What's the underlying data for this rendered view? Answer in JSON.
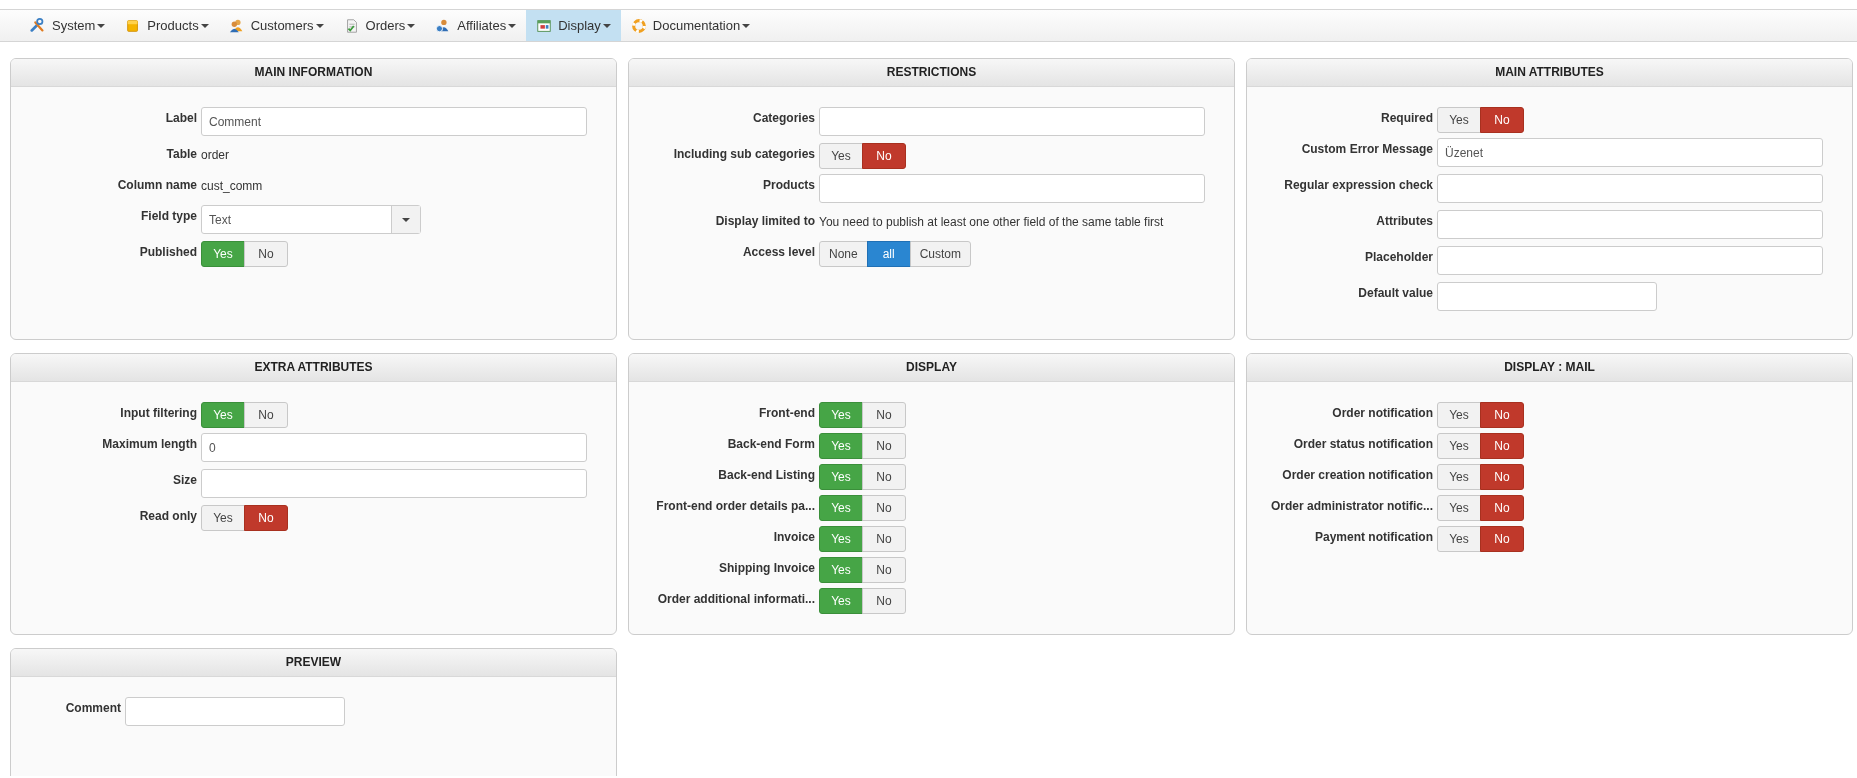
{
  "menu": [
    {
      "label": "System",
      "selected": false
    },
    {
      "label": "Products",
      "selected": false
    },
    {
      "label": "Customers",
      "selected": false
    },
    {
      "label": "Orders",
      "selected": false
    },
    {
      "label": "Affiliates",
      "selected": false
    },
    {
      "label": "Display",
      "selected": true
    },
    {
      "label": "Documentation",
      "selected": false
    }
  ],
  "panels": [
    {
      "title": "MAIN INFORMATION",
      "rows": [
        {
          "kind": "input",
          "label": "Label",
          "value": "Comment"
        },
        {
          "kind": "text",
          "label": "Table",
          "value": "order"
        },
        {
          "kind": "text",
          "label": "Column name",
          "value": "cust_comm"
        },
        {
          "kind": "select",
          "label": "Field type",
          "value": "Text"
        },
        {
          "kind": "toggle",
          "label": "Published",
          "options": [
            {
              "label": "Yes",
              "selected": true
            },
            {
              "label": "No",
              "selected": false
            }
          ]
        }
      ]
    },
    {
      "title": "RESTRICTIONS",
      "rows": [
        {
          "kind": "input",
          "label": "Categories",
          "value": ""
        },
        {
          "kind": "toggle",
          "label": "Including sub categories",
          "options": [
            {
              "label": "Yes",
              "selected": false
            },
            {
              "label": "No",
              "selected": true
            }
          ]
        },
        {
          "kind": "input",
          "label": "Products",
          "value": ""
        },
        {
          "kind": "text",
          "label": "Display limited to",
          "value": "You need to publish at least one other field of the same table first"
        },
        {
          "kind": "choice",
          "label": "Access level",
          "options": [
            {
              "label": "None",
              "selected": false
            },
            {
              "label": "all",
              "selected": true
            },
            {
              "label": "Custom",
              "selected": false
            }
          ]
        }
      ]
    },
    {
      "title": "MAIN ATTRIBUTES",
      "rows": [
        {
          "kind": "toggle",
          "label": "Required",
          "options": [
            {
              "label": "Yes",
              "selected": false
            },
            {
              "label": "No",
              "selected": true
            }
          ]
        },
        {
          "kind": "input",
          "label": "Custom Error Message",
          "value": "Üzenet"
        },
        {
          "kind": "input",
          "label": "Regular expression check",
          "value": ""
        },
        {
          "kind": "input",
          "label": "Attributes",
          "value": ""
        },
        {
          "kind": "input",
          "label": "Placeholder",
          "value": ""
        },
        {
          "kind": "input_short",
          "label": "Default value",
          "value": ""
        }
      ]
    },
    {
      "title": "EXTRA ATTRIBUTES",
      "rows": [
        {
          "kind": "toggle",
          "label": "Input filtering",
          "options": [
            {
              "label": "Yes",
              "selected": true
            },
            {
              "label": "No",
              "selected": false
            }
          ]
        },
        {
          "kind": "input",
          "label": "Maximum length",
          "value": "0"
        },
        {
          "kind": "input",
          "label": "Size",
          "value": ""
        },
        {
          "kind": "toggle",
          "label": "Read only",
          "options": [
            {
              "label": "Yes",
              "selected": false
            },
            {
              "label": "No",
              "selected": true
            }
          ]
        }
      ]
    },
    {
      "title": "DISPLAY",
      "rows": [
        {
          "kind": "toggle",
          "label": "Front-end",
          "options": [
            {
              "label": "Yes",
              "selected": true
            },
            {
              "label": "No",
              "selected": false
            }
          ]
        },
        {
          "kind": "toggle",
          "label": "Back-end Form",
          "options": [
            {
              "label": "Yes",
              "selected": true
            },
            {
              "label": "No",
              "selected": false
            }
          ]
        },
        {
          "kind": "toggle",
          "label": "Back-end Listing",
          "options": [
            {
              "label": "Yes",
              "selected": true
            },
            {
              "label": "No",
              "selected": false
            }
          ]
        },
        {
          "kind": "toggle",
          "label": "Front-end order details pa...",
          "options": [
            {
              "label": "Yes",
              "selected": true
            },
            {
              "label": "No",
              "selected": false
            }
          ]
        },
        {
          "kind": "toggle",
          "label": "Invoice",
          "options": [
            {
              "label": "Yes",
              "selected": true
            },
            {
              "label": "No",
              "selected": false
            }
          ]
        },
        {
          "kind": "toggle",
          "label": "Shipping Invoice",
          "options": [
            {
              "label": "Yes",
              "selected": true
            },
            {
              "label": "No",
              "selected": false
            }
          ]
        },
        {
          "kind": "toggle",
          "label": "Order additional informati...",
          "options": [
            {
              "label": "Yes",
              "selected": true
            },
            {
              "label": "No",
              "selected": false
            }
          ]
        }
      ]
    },
    {
      "title": "DISPLAY : MAIL",
      "rows": [
        {
          "kind": "toggle",
          "label": "Order notification",
          "options": [
            {
              "label": "Yes",
              "selected": false
            },
            {
              "label": "No",
              "selected": true
            }
          ]
        },
        {
          "kind": "toggle",
          "label": "Order status notification",
          "options": [
            {
              "label": "Yes",
              "selected": false
            },
            {
              "label": "No",
              "selected": true
            }
          ]
        },
        {
          "kind": "toggle",
          "label": "Order creation notification",
          "options": [
            {
              "label": "Yes",
              "selected": false
            },
            {
              "label": "No",
              "selected": true
            }
          ]
        },
        {
          "kind": "toggle",
          "label": "Order administrator notific...",
          "options": [
            {
              "label": "Yes",
              "selected": false
            },
            {
              "label": "No",
              "selected": true
            }
          ]
        },
        {
          "kind": "toggle",
          "label": "Payment notification",
          "options": [
            {
              "label": "Yes",
              "selected": false
            },
            {
              "label": "No",
              "selected": true
            }
          ]
        }
      ]
    },
    {
      "title": "PREVIEW",
      "rows": [
        {
          "kind": "input_short",
          "label": "Comment",
          "value": ""
        }
      ]
    }
  ]
}
